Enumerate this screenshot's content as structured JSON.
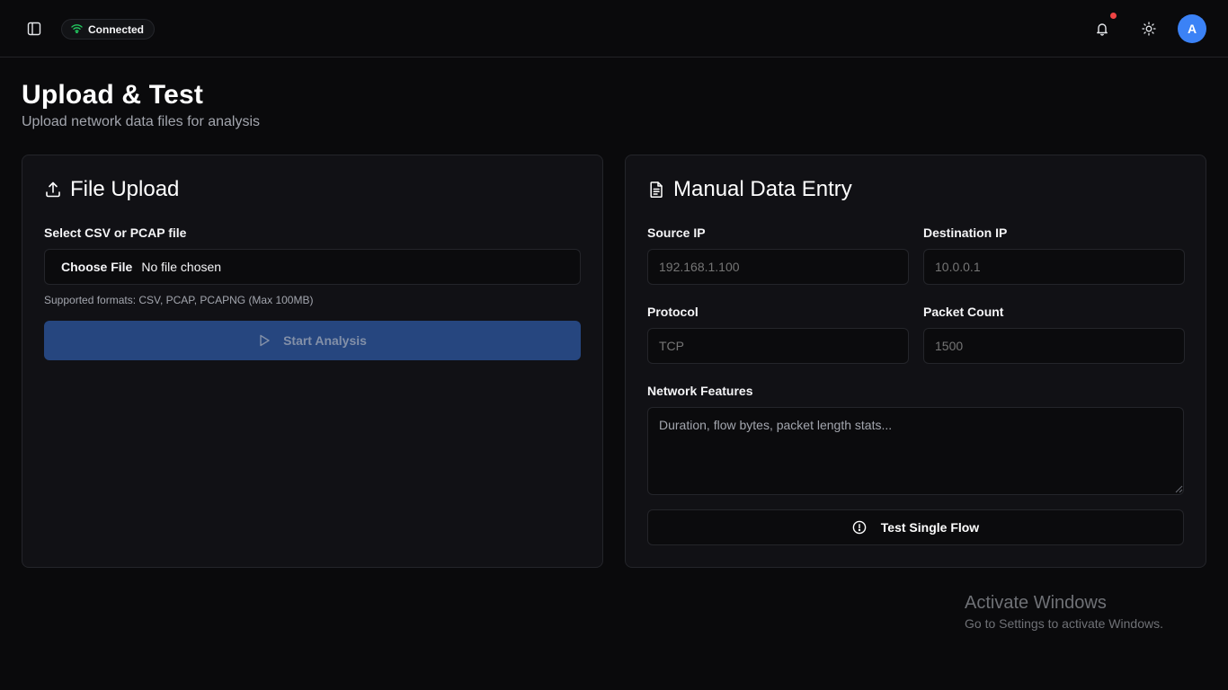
{
  "header": {
    "status_label": "Connected",
    "status_color": "#22c55e",
    "avatar_initial": "A",
    "notification_dot_color": "#ef4444",
    "icons": [
      "panel-left-icon",
      "wifi-icon",
      "bell-icon",
      "sun-icon"
    ]
  },
  "page": {
    "title": "Upload & Test",
    "subtitle": "Upload network data files for analysis"
  },
  "file_upload": {
    "title": "File Upload",
    "field_label": "Select CSV or PCAP file",
    "choose_label": "Choose File",
    "file_status": "No file chosen",
    "helper": "Supported formats: CSV, PCAP, PCAPNG (Max 100MB)",
    "start_label": "Start Analysis"
  },
  "manual_entry": {
    "title": "Manual Data Entry",
    "source_ip_label": "Source IP",
    "source_ip_placeholder": "192.168.1.100",
    "destination_ip_label": "Destination IP",
    "destination_ip_placeholder": "10.0.0.1",
    "protocol_label": "Protocol",
    "protocol_placeholder": "TCP",
    "packet_count_label": "Packet Count",
    "packet_count_placeholder": "1500",
    "features_label": "Network Features",
    "features_placeholder": "Duration, flow bytes, packet length stats...",
    "test_label": "Test Single Flow"
  },
  "watermark": {
    "title": "Activate Windows",
    "subtitle": "Go to Settings to activate Windows."
  },
  "colors": {
    "background": "#0a0a0c",
    "card": "#111115",
    "accent_button": "#26467f",
    "avatar": "#3b82f6"
  }
}
